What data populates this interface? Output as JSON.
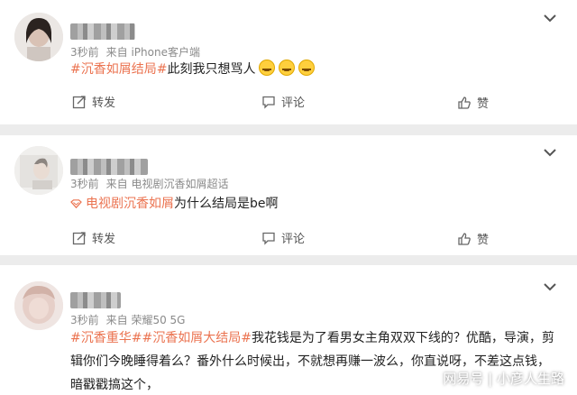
{
  "posts": [
    {
      "time": "3秒前",
      "source": "来自 iPhone客户端",
      "tag": "#沉香如屑结局#",
      "text": "此刻我只想骂人",
      "actions": {
        "repost": "转发",
        "comment": "评论",
        "like": "赞"
      }
    },
    {
      "time": "3秒前",
      "source": "来自 电视剧沉香如屑超话",
      "tag": "电视剧沉香如屑",
      "text": "为什么结局是be啊",
      "actions": {
        "repost": "转发",
        "comment": "评论",
        "like": "赞"
      }
    },
    {
      "time": "3秒前",
      "source": "来自 荣耀50 5G",
      "tag1": "#沉香重华#",
      "tag2": "#沉香如屑大结局#",
      "text": "我花钱是为了看男女主角双双下线的？优酷，导演，剪辑你们今晚睡得着么？番外什么时候出，不就想再赚一波么，你直说呀，不差这点钱，暗戳戳搞这个，"
    }
  ],
  "watermark": "网易号 | 小彦人生路"
}
